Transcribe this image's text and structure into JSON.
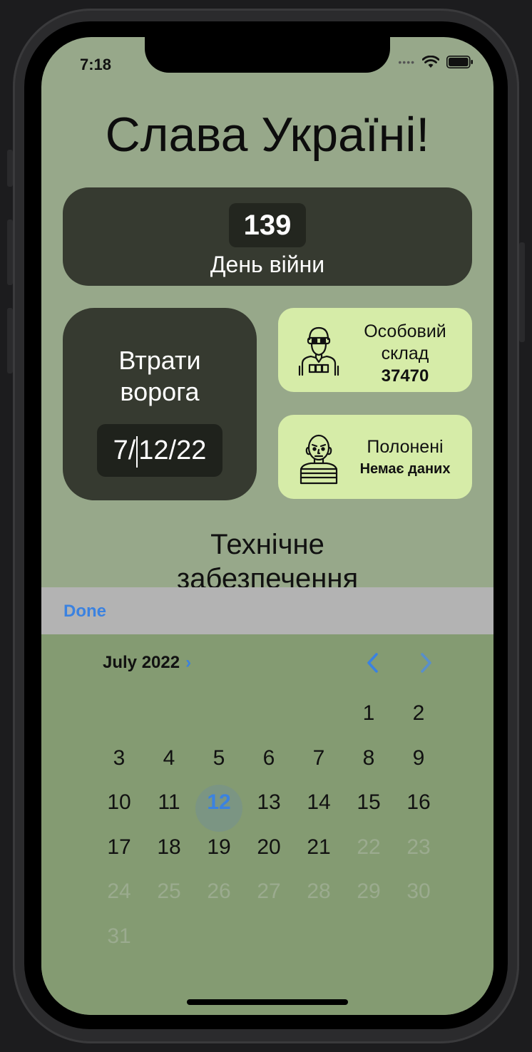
{
  "status": {
    "time": "7:18"
  },
  "title": "Слава Україні!",
  "war_day": {
    "number": "139",
    "label": "День війни"
  },
  "losses": {
    "title_line1": "Втрати",
    "title_line2": "ворога",
    "date_before_caret": "7/",
    "date_after_caret": "12/22"
  },
  "personnel": {
    "line1": "Особовий",
    "line2": "склад",
    "value": "37470"
  },
  "prisoners": {
    "line1": "Полонені",
    "value": "Немає даних"
  },
  "tech": {
    "line1": "Технічне",
    "line2": "забезпечення"
  },
  "toolbar": {
    "done_label": "Done"
  },
  "calendar": {
    "month_label": "July 2022",
    "selected_day": 12,
    "leading_blanks": 5,
    "days_enabled": [
      "1",
      "2",
      "3",
      "4",
      "5",
      "6",
      "7",
      "8",
      "9",
      "10",
      "11",
      "12",
      "13",
      "14",
      "15",
      "16",
      "17",
      "18",
      "19",
      "20",
      "21"
    ],
    "days_disabled": [
      "22",
      "23",
      "24",
      "25",
      "26",
      "27",
      "28",
      "29",
      "30",
      "31"
    ]
  },
  "colors": {
    "accent": "#3b82e0",
    "screen_bg": "#97a88a",
    "card_dark": "#363a30",
    "card_light": "#d6eca8",
    "picker_bg": "#849b72"
  }
}
